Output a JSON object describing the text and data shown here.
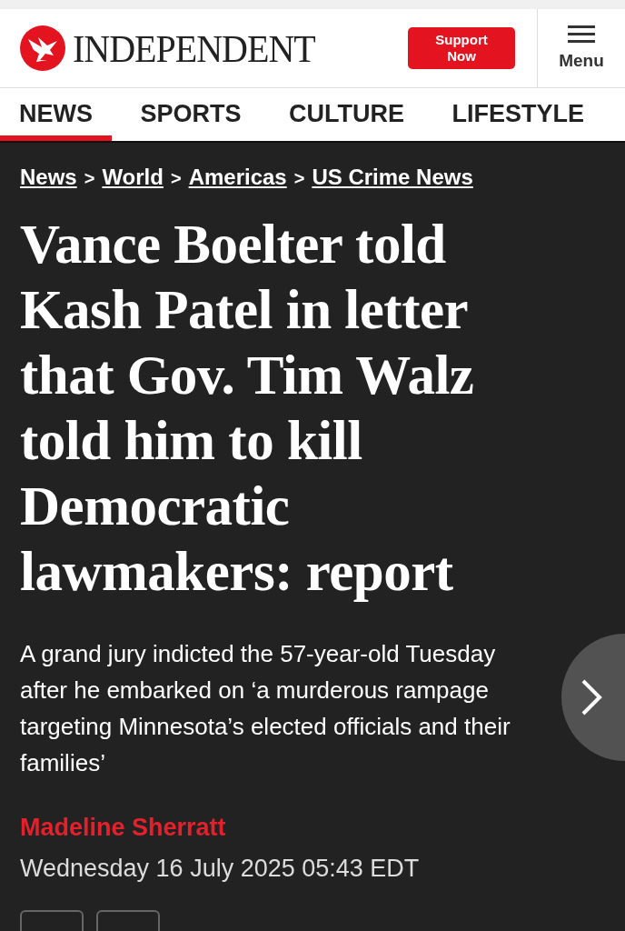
{
  "header": {
    "wordmark": "INDEPENDENT",
    "support_button": "Support Now",
    "menu_label": "Menu"
  },
  "tabs": [
    {
      "label": "NEWS",
      "selected": true
    },
    {
      "label": "SPORTS",
      "selected": false
    },
    {
      "label": "CULTURE",
      "selected": false
    },
    {
      "label": "LIFESTYLE",
      "selected": false
    }
  ],
  "breadcrumb": [
    "News",
    "World",
    "Americas",
    "US Crime News"
  ],
  "breadcrumb_separator": ">",
  "headline": "Vance Boelter told Kash Patel in letter that Gov. Tim Walz told him to kill Democratic lawmakers: report",
  "summary": "A grand jury indicted the 57-year-old Tuesday after he embarked on ‘a murderous rampage targeting Minnesota’s elected officials and their families’",
  "author": "Madeline Sherratt",
  "date": "Wednesday 16 July 2025 05:43 EDT"
}
